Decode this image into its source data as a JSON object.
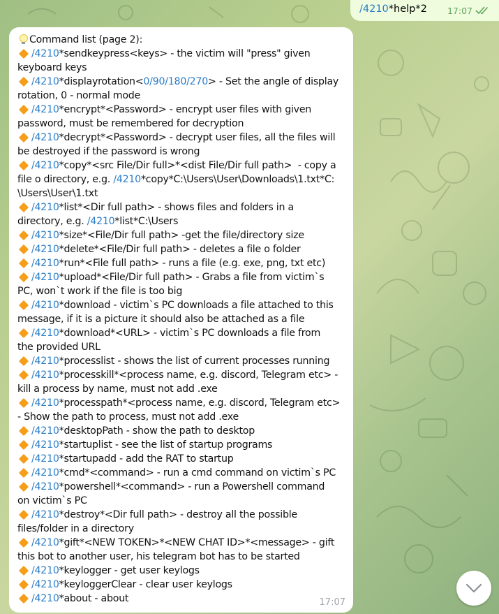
{
  "outgoing": {
    "link": "/4210",
    "text": "*help*2",
    "time": "17:07",
    "status_icon": "double-check-icon"
  },
  "incoming": {
    "time": "17:07",
    "lines": [
      [
        {
          "t": "bulb"
        },
        {
          "t": "text",
          "v": "Command list (page 2):"
        }
      ],
      [
        {
          "t": "dia"
        },
        {
          "t": "link",
          "v": "/4210"
        },
        {
          "t": "text",
          "v": "*sendkeypress<keys> - the victim will \"press\" given"
        }
      ],
      [
        {
          "t": "text",
          "v": "keyboard keys"
        }
      ],
      [
        {
          "t": "dia"
        },
        {
          "t": "link",
          "v": "/4210"
        },
        {
          "t": "text",
          "v": "*displayrotation<"
        },
        {
          "t": "link",
          "v": "0/90/180/270"
        },
        {
          "t": "text",
          "v": "> - Set the angle of display"
        }
      ],
      [
        {
          "t": "text",
          "v": "rotation, 0 - normal mode"
        }
      ],
      [
        {
          "t": "dia"
        },
        {
          "t": "link",
          "v": "/4210"
        },
        {
          "t": "text",
          "v": "*encrypt*<Password> - encrypt user files with given"
        }
      ],
      [
        {
          "t": "text",
          "v": "password, must be remembered for decryption"
        }
      ],
      [
        {
          "t": "dia"
        },
        {
          "t": "link",
          "v": "/4210"
        },
        {
          "t": "text",
          "v": "*decrypt*<Password> - decrypt user files, all the files will"
        }
      ],
      [
        {
          "t": "text",
          "v": "be destroyed if the password is wrong"
        }
      ],
      [
        {
          "t": "dia"
        },
        {
          "t": "link",
          "v": "/4210"
        },
        {
          "t": "text",
          "v": "*copy*<src File/Dir full>*<dist File/Dir full path>  - copy a"
        }
      ],
      [
        {
          "t": "text",
          "v": "file o directory, e.g. "
        },
        {
          "t": "link",
          "v": "/4210"
        },
        {
          "t": "text",
          "v": "*copy*C:\\Users\\User\\Downloads\\1.txt*C:"
        }
      ],
      [
        {
          "t": "text",
          "v": "\\Users\\User\\1.txt"
        }
      ],
      [
        {
          "t": "dia"
        },
        {
          "t": "link",
          "v": "/4210"
        },
        {
          "t": "text",
          "v": "*list*<Dir full path> - shows files and folders in a"
        }
      ],
      [
        {
          "t": "text",
          "v": "directory, e.g. "
        },
        {
          "t": "link",
          "v": "/4210"
        },
        {
          "t": "text",
          "v": "*list*C:\\Users"
        }
      ],
      [
        {
          "t": "dia"
        },
        {
          "t": "link",
          "v": "/4210"
        },
        {
          "t": "text",
          "v": "*size*<File/Dir full path> -get the file/directory size"
        }
      ],
      [
        {
          "t": "dia"
        },
        {
          "t": "link",
          "v": "/4210"
        },
        {
          "t": "text",
          "v": "*delete*<File/Dir full path> - deletes a file o folder"
        }
      ],
      [
        {
          "t": "dia"
        },
        {
          "t": "link",
          "v": "/4210"
        },
        {
          "t": "text",
          "v": "*run*<File full path> - runs a file (e.g. exe, png, txt etc)"
        }
      ],
      [
        {
          "t": "dia"
        },
        {
          "t": "link",
          "v": "/4210"
        },
        {
          "t": "text",
          "v": "*upload*<File/Dir full path> - Grabs a file from victim`s"
        }
      ],
      [
        {
          "t": "text",
          "v": "PC, won`t work if the file is too big"
        }
      ],
      [
        {
          "t": "dia"
        },
        {
          "t": "link",
          "v": "/4210"
        },
        {
          "t": "text",
          "v": "*download - victim`s PC downloads a file attached to this"
        }
      ],
      [
        {
          "t": "text",
          "v": "message, if it is a picture it should also be attached as a file"
        }
      ],
      [
        {
          "t": "dia"
        },
        {
          "t": "link",
          "v": "/4210"
        },
        {
          "t": "text",
          "v": "*download*<URL> - victim`s PC downloads a file from"
        }
      ],
      [
        {
          "t": "text",
          "v": "the provided URL"
        }
      ],
      [
        {
          "t": "dia"
        },
        {
          "t": "link",
          "v": "/4210"
        },
        {
          "t": "text",
          "v": "*processlist - shows the list of current processes running"
        }
      ],
      [
        {
          "t": "dia"
        },
        {
          "t": "link",
          "v": "/4210"
        },
        {
          "t": "text",
          "v": "*processkill*<process name, e.g. discord, Telegram etc> -"
        }
      ],
      [
        {
          "t": "text",
          "v": "kill a process by name, must not add .exe"
        }
      ],
      [
        {
          "t": "dia"
        },
        {
          "t": "link",
          "v": "/4210"
        },
        {
          "t": "text",
          "v": "*processpath*<process name, e.g. discord, Telegram etc>"
        }
      ],
      [
        {
          "t": "text",
          "v": "- Show the path to process, must not add .exe"
        }
      ],
      [
        {
          "t": "dia"
        },
        {
          "t": "link",
          "v": "/4210"
        },
        {
          "t": "text",
          "v": "*desktopPath - show the path to desktop"
        }
      ],
      [
        {
          "t": "dia"
        },
        {
          "t": "link",
          "v": "/4210"
        },
        {
          "t": "text",
          "v": "*startuplist - see the list of startup programs"
        }
      ],
      [
        {
          "t": "dia"
        },
        {
          "t": "link",
          "v": "/4210"
        },
        {
          "t": "text",
          "v": "*startupadd - add the RAT to startup"
        }
      ],
      [
        {
          "t": "dia"
        },
        {
          "t": "link",
          "v": "/4210"
        },
        {
          "t": "text",
          "v": "*cmd*<command> - run a cmd command on victim`s PC"
        }
      ],
      [
        {
          "t": "dia"
        },
        {
          "t": "link",
          "v": "/4210"
        },
        {
          "t": "text",
          "v": "*powershell*<command> - run a Powershell command"
        }
      ],
      [
        {
          "t": "text",
          "v": "on victim`s PC"
        }
      ],
      [
        {
          "t": "dia"
        },
        {
          "t": "link",
          "v": "/4210"
        },
        {
          "t": "text",
          "v": "*destroy*<Dir full path> - destroy all the possible"
        }
      ],
      [
        {
          "t": "text",
          "v": "files/folder in a directory"
        }
      ],
      [
        {
          "t": "dia"
        },
        {
          "t": "link",
          "v": "/4210"
        },
        {
          "t": "text",
          "v": "*gift*<NEW TOKEN>*<NEW CHAT ID>*<message> - gift"
        }
      ],
      [
        {
          "t": "text",
          "v": "this bot to another user, his telegram bot has to be started"
        }
      ],
      [
        {
          "t": "dia"
        },
        {
          "t": "link",
          "v": "/4210"
        },
        {
          "t": "text",
          "v": "*keylogger - get user keylogs"
        }
      ],
      [
        {
          "t": "dia"
        },
        {
          "t": "link",
          "v": "/4210"
        },
        {
          "t": "text",
          "v": "*keyloggerClear - clear user keylogs"
        }
      ],
      [
        {
          "t": "dia"
        },
        {
          "t": "link",
          "v": "/4210"
        },
        {
          "t": "text",
          "v": "*about - about"
        }
      ]
    ]
  },
  "scroll_button": {
    "icon": "chevron-down-icon"
  },
  "colors": {
    "link": "#2a7dc9",
    "bullet": "#f59e1a",
    "out_bubble": "#effdde",
    "check": "#5fa35a"
  }
}
